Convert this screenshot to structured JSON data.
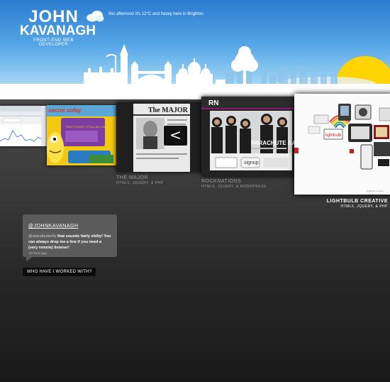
{
  "header": {
    "logo": {
      "first": "JOHN",
      "last": "KAVANAGH",
      "tagline": "FRONT-END WEB DEVELOPER"
    },
    "weather": {
      "icon": "cloud-icon",
      "text": "this afternoon it's 12°C and hazey here in Brighton."
    }
  },
  "colors": {
    "sky_top": "#2b7bd1",
    "sky_bottom": "#cfe9fb",
    "sun": "#ffd400",
    "page_bg": "#2a2a2a",
    "bubble": "#5b5b5b"
  },
  "portfolio": {
    "items": [
      {
        "label": "",
        "tech": ""
      },
      {
        "label": "",
        "tech": ""
      },
      {
        "label": "THE MAJOR",
        "tech": "HTML5, JQUERY, & PHP",
        "nav_icon": "chevron-left-icon",
        "nav_symbol": "<"
      },
      {
        "label": "ROCKNATIONS",
        "tech": "HTML5, JQUERY, & WORDPRESS",
        "site_title": "PARACHUTE BAND",
        "signup": "signup"
      },
      {
        "label": "LIGHTBULB CREATIVE",
        "tech": "HTML5, JQUERY, & PHP"
      }
    ],
    "screens": {
      "site2_title": "secret sofay",
      "site2_subtitle": "THAT'S RIGHT, IT'S A LAN CHAT!",
      "site3_title": "The MAJOR",
      "site4_logo": "RN",
      "site5_footer": "Lightbulb Creative",
      "site5_sticker": "lightbulb"
    }
  },
  "twitter": {
    "handle": "@JOHNKAVANAGH",
    "mention": "@islandbutterfly",
    "text": " that sounds fairly shitty! You can always drop me a line if you need a (very remote) listener!",
    "time": "18 hours ago"
  },
  "cta": {
    "worked_with": "WHO HAVE I WORKED WITH?"
  }
}
